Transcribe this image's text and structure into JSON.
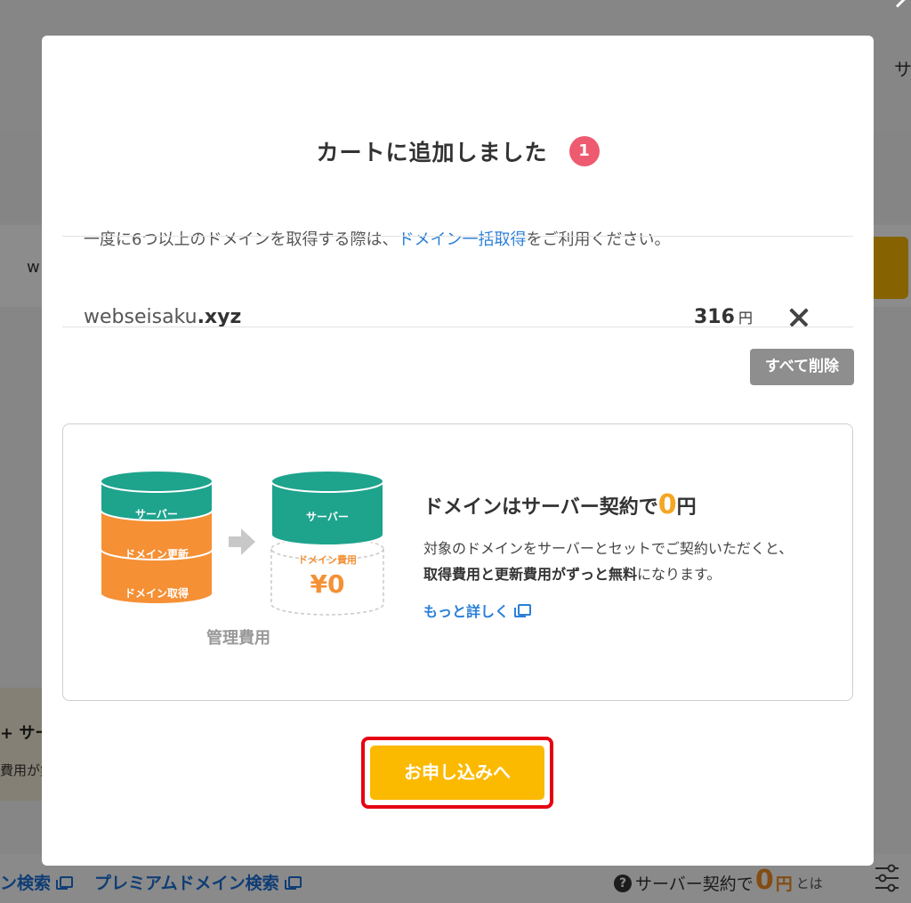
{
  "background": {
    "card_text": "w",
    "promo_line1": "+ サー",
    "promo_line2": "費用が無",
    "right_letter": "サ",
    "links": [
      {
        "label": "ン検索"
      },
      {
        "label": "プレミアムドメイン検索"
      }
    ],
    "server_note": {
      "prefix": "サーバー契約で",
      "zero": "0",
      "yen": "円",
      "suffix": "とは"
    }
  },
  "modal": {
    "title": "カートに追加しました",
    "count": "1",
    "notice": {
      "before": "一度に6つ以上のドメインを取得する際は、",
      "link": "ドメイン一括取得",
      "after": "をご利用ください。"
    },
    "cart_item": {
      "name": "webseisaku",
      "tld": ".xyz",
      "price": "316",
      "currency": "円"
    },
    "delete_all_label": "すべて削除",
    "promo": {
      "heading_before": "ドメインはサーバー契約で",
      "heading_zero": "0",
      "heading_after": "円",
      "body_line1": "対象のドメインをサーバーとセットでご契約いただくと、",
      "body_line2_bold": "取得費用と更新費用がずっと無料",
      "body_line2_rest": "になります。",
      "more_link": "もっと詳しく",
      "illustration": {
        "server": "サーバー",
        "domain_renewal": "ドメイン更新",
        "domain_acquire": "ドメイン取得",
        "domain_fee": "ドメイン費用",
        "fee_value": "¥0",
        "caption": "管理費用"
      }
    },
    "apply_label": "お申し込みへ"
  },
  "colors": {
    "accent_yellow": "#fbb900",
    "badge_red": "#ee5a6f",
    "link_blue": "#2b7fd9",
    "highlight_border": "#e60012",
    "teal": "#1ea38d",
    "orange": "#f59035"
  }
}
